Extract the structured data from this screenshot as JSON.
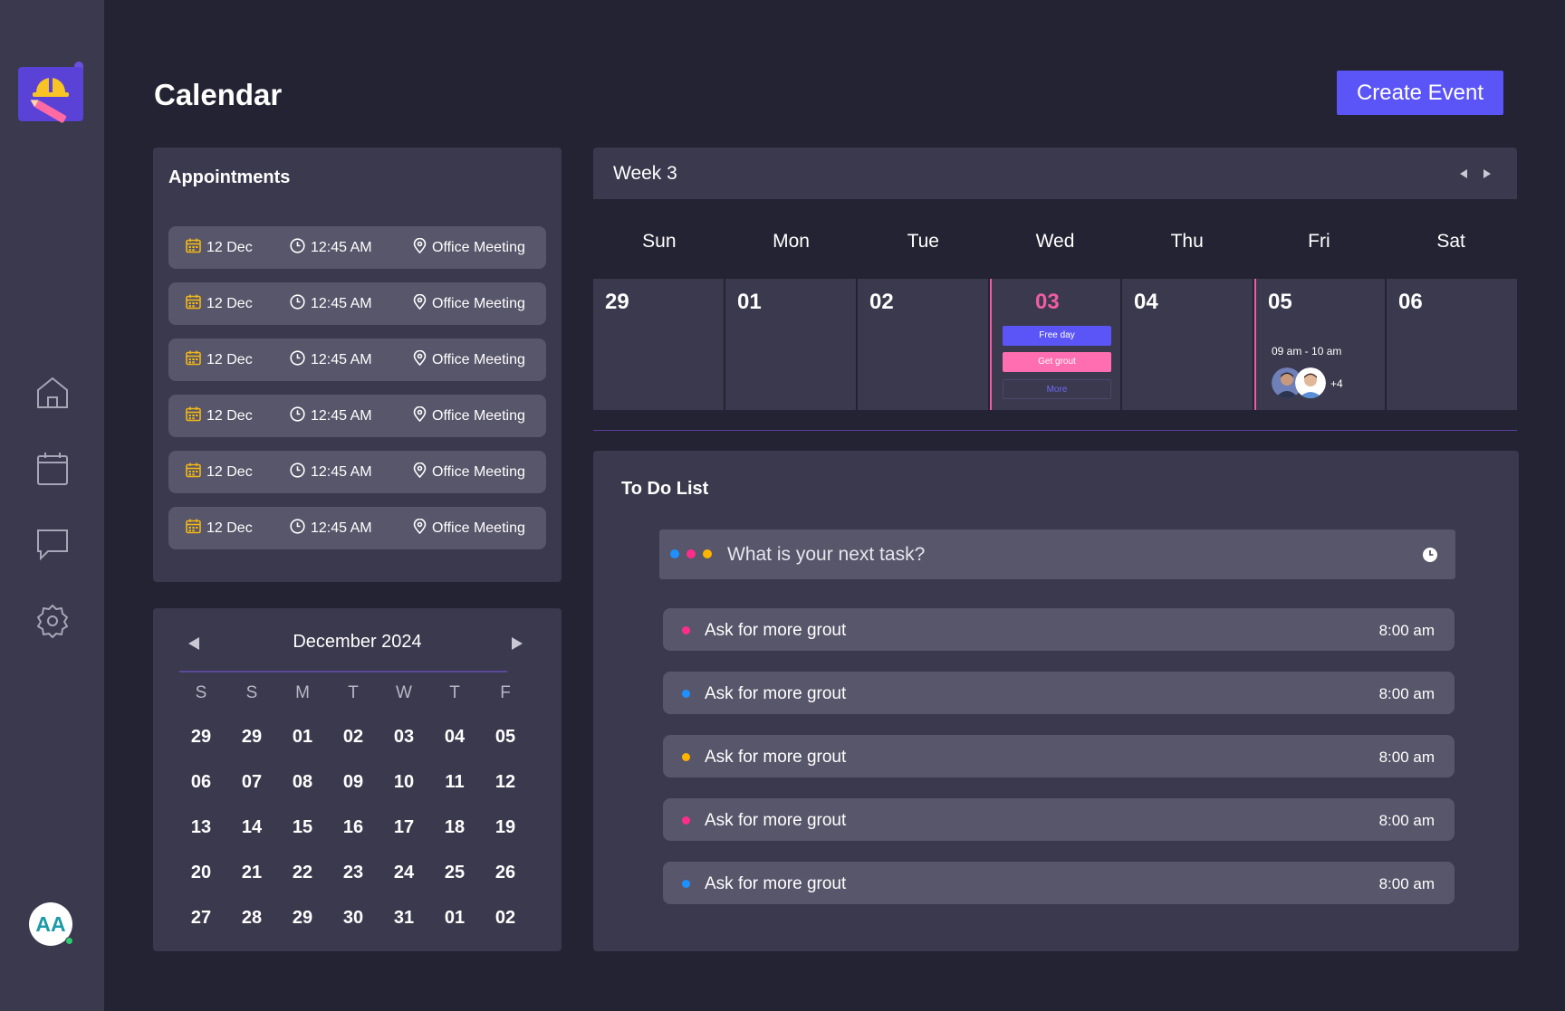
{
  "page": {
    "title": "Calendar",
    "create_button": "Create Event"
  },
  "sidebar": {
    "nav": [
      "home-icon",
      "calendar-icon",
      "chat-icon",
      "settings-icon"
    ],
    "avatar_initials": "AA"
  },
  "appointments": {
    "title": "Appointments",
    "items": [
      {
        "date": "12 Dec",
        "time": "12:45 AM",
        "location": "Office Meeting"
      },
      {
        "date": "12 Dec",
        "time": "12:45 AM",
        "location": "Office Meeting"
      },
      {
        "date": "12 Dec",
        "time": "12:45 AM",
        "location": "Office Meeting"
      },
      {
        "date": "12 Dec",
        "time": "12:45 AM",
        "location": "Office Meeting"
      },
      {
        "date": "12 Dec",
        "time": "12:45 AM",
        "location": "Office Meeting"
      },
      {
        "date": "12 Dec",
        "time": "12:45 AM",
        "location": "Office Meeting"
      }
    ]
  },
  "mini_calendar": {
    "month": "December 2024",
    "weekdays": [
      "S",
      "S",
      "M",
      "T",
      "W",
      "T",
      "F"
    ],
    "days": [
      "29",
      "29",
      "01",
      "02",
      "03",
      "04",
      "05",
      "06",
      "07",
      "08",
      "09",
      "10",
      "11",
      "12",
      "13",
      "14",
      "15",
      "16",
      "17",
      "18",
      "19",
      "20",
      "21",
      "22",
      "23",
      "24",
      "25",
      "26",
      "27",
      "28",
      "29",
      "30",
      "31",
      "01",
      "02"
    ]
  },
  "week": {
    "title": "Week 3",
    "weekdays": [
      "Sun",
      "Mon",
      "Tue",
      "Wed",
      "Thu",
      "Fri",
      "Sat"
    ],
    "days": [
      "29",
      "01",
      "02",
      "03",
      "04",
      "05",
      "06"
    ],
    "wed_events": {
      "free": "Free day",
      "grout": "Get grout",
      "more": "More"
    },
    "fri": {
      "time": "09 am - 10 am",
      "more_count": "+4"
    }
  },
  "todo": {
    "title": "To Do List",
    "input_placeholder": "What is your next task?",
    "tasks": [
      {
        "label": "Ask for more grout",
        "time": "8:00 am",
        "color": "#ff2d8a"
      },
      {
        "label": "Ask for more grout",
        "time": "8:00 am",
        "color": "#1e90ff"
      },
      {
        "label": "Ask for more grout",
        "time": "8:00 am",
        "color": "#ffb400"
      },
      {
        "label": "Ask for more grout",
        "time": "8:00 am",
        "color": "#ff2d8a"
      },
      {
        "label": "Ask for more grout",
        "time": "8:00 am",
        "color": "#1e90ff"
      }
    ]
  },
  "colors": {
    "accent": "#5b55f7",
    "pink": "#ee5da3",
    "panel": "#3a394d",
    "background": "#232333"
  }
}
